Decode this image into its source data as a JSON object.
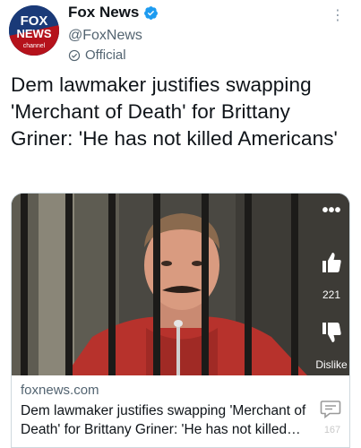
{
  "account": {
    "name": "Fox News",
    "handle": "@FoxNews",
    "label": "Official",
    "avatar_text_1": "FOX",
    "avatar_text_2": "NEWS",
    "avatar_text_3": "channel"
  },
  "tweet": {
    "text": "Dem lawmaker justifies swapping 'Merchant of Death' for Brittany Griner: 'He has not killed Americans'"
  },
  "card": {
    "domain": "foxnews.com",
    "title": "Dem lawmaker justifies swapping 'Merchant of Death' for Brittany Griner: 'He has not killed Americans'"
  },
  "overlay": {
    "more": "•••",
    "like_count": "221",
    "dislike_label": "Dislike",
    "comment_count": "167"
  },
  "colors": {
    "verified": "#1d9bf0",
    "text": "#0f1419",
    "secondary": "#536471"
  }
}
